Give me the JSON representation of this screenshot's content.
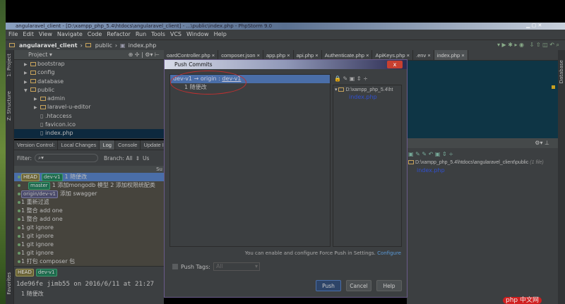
{
  "window": {
    "title": "angularavel_client - [D:\\xampp_php_5.4\\htdocs\\angularavel_client] - ...\\public\\index.php - PhpStorm 9.0"
  },
  "menu": [
    "File",
    "Edit",
    "View",
    "Navigate",
    "Code",
    "Refactor",
    "Run",
    "Tools",
    "VCS",
    "Window",
    "Help"
  ],
  "breadcrumb": [
    "angularavel_client",
    "public",
    "index.php"
  ],
  "left_strip": {
    "project": "1: Project",
    "structure": "Z: Structure",
    "favorites": "Favorites"
  },
  "right_strip": {
    "database": "Database"
  },
  "project": {
    "title": "Project",
    "tree": [
      {
        "label": "bootstrap",
        "type": "folder",
        "open": false,
        "depth": 1
      },
      {
        "label": "config",
        "type": "folder",
        "open": false,
        "depth": 1
      },
      {
        "label": "database",
        "type": "folder",
        "open": false,
        "depth": 1
      },
      {
        "label": "public",
        "type": "folder",
        "open": true,
        "depth": 1
      },
      {
        "label": "admin",
        "type": "folder",
        "open": false,
        "depth": 2
      },
      {
        "label": "laravel-u-editor",
        "type": "folder",
        "open": false,
        "depth": 2
      },
      {
        "label": ".htaccess",
        "type": "file",
        "depth": 2
      },
      {
        "label": "favicon.ico",
        "type": "file",
        "depth": 2
      },
      {
        "label": "index.php",
        "type": "file",
        "depth": 2
      }
    ]
  },
  "editor_tabs": [
    "oardController.php",
    "composer.json",
    "app.php",
    "api.php",
    "Authenticate.php",
    "ApiKeys.php",
    ".env",
    "index.php"
  ],
  "vcs": {
    "tabs": [
      "Version Control:",
      "Local Changes",
      "Log",
      "Console",
      "Update Info:"
    ],
    "active_tab": "Log",
    "filter_label": "Filter:",
    "branch_label": "Branch: All",
    "user_label": "Us",
    "col_header": "Su",
    "log": [
      {
        "tags": [
          "HEAD",
          "dev-v1"
        ],
        "msg": "1 随便改"
      },
      {
        "tags": [
          "master"
        ],
        "msg": "1 添加mongodb 模型 2 添加权限统配类"
      },
      {
        "tags": [
          "origin/dev-v1"
        ],
        "msg": "添加 swagger"
      },
      {
        "tags": [],
        "msg": "1 重新过滤"
      },
      {
        "tags": [],
        "msg": "1 整合 add  one"
      },
      {
        "tags": [],
        "msg": "1 整合 add  one"
      },
      {
        "tags": [],
        "msg": "1 git ignore"
      },
      {
        "tags": [],
        "msg": "1 git ignore"
      },
      {
        "tags": [],
        "msg": "1 git ignore"
      },
      {
        "tags": [],
        "msg": "1 git ignore"
      },
      {
        "tags": [],
        "msg": "1 打包 composer 包"
      }
    ],
    "detail_tags": [
      "HEAD",
      "dev-v1"
    ],
    "detail_line": "1de96fe jimb55 on 2016/6/11 at 21:27",
    "detail_msg": "1 随便改"
  },
  "changes": {
    "path": "D:\\xampp_php_5.4\\htdocs\\angularavel_client\\public",
    "count": "(1 file)",
    "file": "index.php"
  },
  "dialog": {
    "title": "Push Commits",
    "branch_from": "dev-v1",
    "arrow": "→",
    "remote": "origin :",
    "branch_to": "dev-v1",
    "commit": "1 随便改",
    "tree_path": "D:\\xampp_php_5.4\\ht",
    "tree_file": "index.php",
    "hint": "You can enable and configure Force Push in Settings.",
    "configure": "Configure",
    "push_tags_label": "Push Tags:",
    "push_tags_value": "All",
    "push": "Push",
    "cancel": "Cancel",
    "help": "Help",
    "close": "x"
  },
  "watermark": "php 中文网"
}
